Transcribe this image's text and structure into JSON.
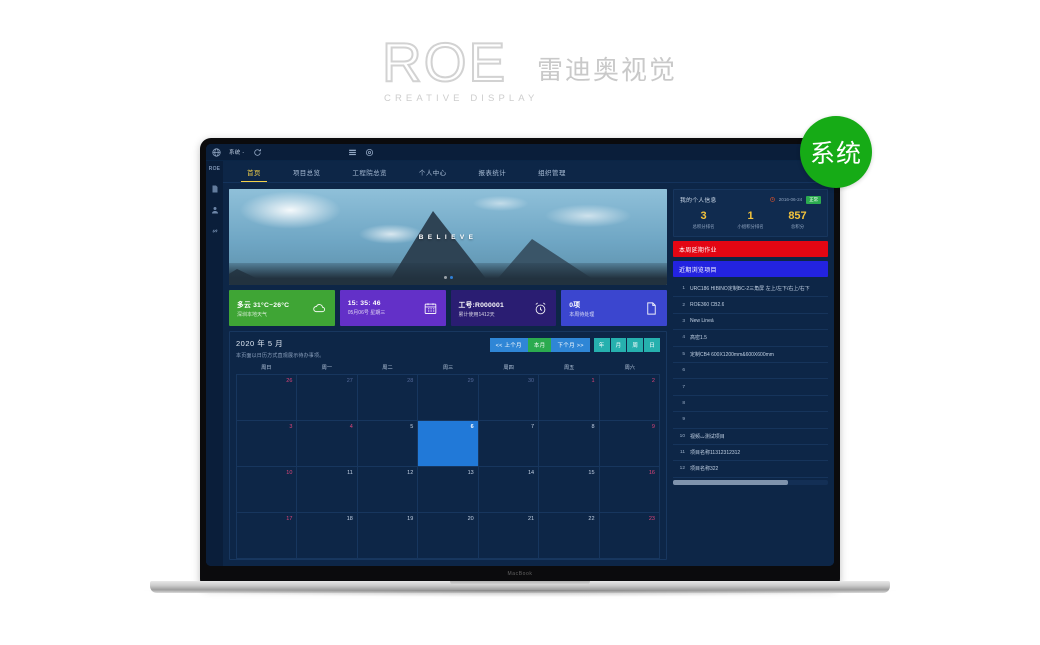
{
  "brand": {
    "name": "ROE",
    "tagline": "CREATIVE DISPLAY",
    "chinese": "雷迪奥视觉"
  },
  "badge": {
    "label": "系统"
  },
  "laptop": {
    "model_label": "MacBook"
  },
  "topbar": {
    "app_icon": "globe-icon",
    "system_label": "系统 -",
    "refresh_icon": "refresh-icon",
    "list_icon": "list-icon",
    "settings_icon": "gear-icon"
  },
  "sidebar": {
    "logo": "ROE",
    "items": [
      {
        "icon": "document-icon"
      },
      {
        "icon": "user-icon"
      },
      {
        "icon": "link-icon"
      }
    ]
  },
  "tabs": [
    {
      "label": "首页",
      "active": true
    },
    {
      "label": "项目总览",
      "active": false
    },
    {
      "label": "工程院总览",
      "active": false
    },
    {
      "label": "个人中心",
      "active": false
    },
    {
      "label": "报表统计",
      "active": false
    },
    {
      "label": "组织管理",
      "active": false
    }
  ],
  "hero": {
    "caption": "BELIEVE",
    "dots": 2,
    "active_dot": 1
  },
  "cards": [
    {
      "title": "多云 31°C~26°C",
      "subtitle": "深圳本地天气",
      "icon": "cloud-icon",
      "color": "#3fa535"
    },
    {
      "title": "15: 35: 46",
      "subtitle": "05月06号 星期三",
      "icon": "calendar-icon",
      "color": "#6330c8"
    },
    {
      "title": "工号:R000001",
      "subtitle": "累计使用1412天",
      "icon": "alarm-icon",
      "color": "#2a1d72"
    },
    {
      "title": "0项",
      "subtitle": "本周待处理",
      "icon": "file-icon",
      "color": "#3b46cf"
    }
  ],
  "calendar": {
    "title": "2020 年 5 月",
    "subtitle": "本页面以日历方式直观展示待办事项。",
    "buttons": {
      "prev": "<< 上个月",
      "current": "本月",
      "next": "下个月 >>",
      "year": "年",
      "month": "月",
      "week": "周",
      "day": "日"
    },
    "weekdays": [
      "周日",
      "周一",
      "周二",
      "周三",
      "周四",
      "周五",
      "周六"
    ],
    "weeks": [
      [
        {
          "n": "26",
          "muted": true,
          "weekend": true
        },
        {
          "n": "27",
          "muted": true
        },
        {
          "n": "28",
          "muted": true
        },
        {
          "n": "29",
          "muted": true
        },
        {
          "n": "30",
          "muted": true
        },
        {
          "n": "1",
          "weekend": true
        },
        {
          "n": "2",
          "weekend": true
        }
      ],
      [
        {
          "n": "3",
          "weekend": true
        },
        {
          "n": "4",
          "weekend": true
        },
        {
          "n": "5"
        },
        {
          "n": "6",
          "selected": true
        },
        {
          "n": "7"
        },
        {
          "n": "8"
        },
        {
          "n": "9",
          "weekend": true
        }
      ],
      [
        {
          "n": "10",
          "weekend": true
        },
        {
          "n": "11"
        },
        {
          "n": "12"
        },
        {
          "n": "13"
        },
        {
          "n": "14"
        },
        {
          "n": "15"
        },
        {
          "n": "16",
          "weekend": true
        }
      ],
      [
        {
          "n": "17",
          "weekend": true
        },
        {
          "n": "18"
        },
        {
          "n": "19"
        },
        {
          "n": "20"
        },
        {
          "n": "21"
        },
        {
          "n": "22"
        },
        {
          "n": "23",
          "weekend": true
        }
      ]
    ]
  },
  "profile": {
    "title": "我的个人信息",
    "date": "2016-06-24",
    "status": "正常",
    "stats": [
      {
        "value": "3",
        "label": "总积分排名"
      },
      {
        "value": "1",
        "label": "小组积分排名"
      },
      {
        "value": "857",
        "label": "总积分"
      }
    ]
  },
  "banners": {
    "overdue": "本周延期作业",
    "recent": "近期浏览项目"
  },
  "recent_list": [
    {
      "n": "1",
      "text": "URC186 HIBINO定制BC-2三角屏 左上/左下/右上/右下"
    },
    {
      "n": "2",
      "text": "ROE360 CB2.6"
    },
    {
      "n": "3",
      "text": "New Lineá"
    },
    {
      "n": "4",
      "text": "高密1.5"
    },
    {
      "n": "5",
      "text": "定制CB4 600X1200mm&600X600mm"
    },
    {
      "n": "6",
      "text": ""
    },
    {
      "n": "7",
      "text": ""
    },
    {
      "n": "8",
      "text": ""
    },
    {
      "n": "9",
      "text": ""
    },
    {
      "n": "10",
      "text": "视频ث测试项目"
    },
    {
      "n": "11",
      "text": "项目名称11312312312"
    },
    {
      "n": "12",
      "text": "项目名称322"
    }
  ],
  "colors": {
    "accent_yellow": "#f3d04a",
    "app_bg": "#0d2647",
    "panel_bg": "#102b4f",
    "red": "#e30613",
    "blue": "#2323e0",
    "green": "#16ab16"
  }
}
